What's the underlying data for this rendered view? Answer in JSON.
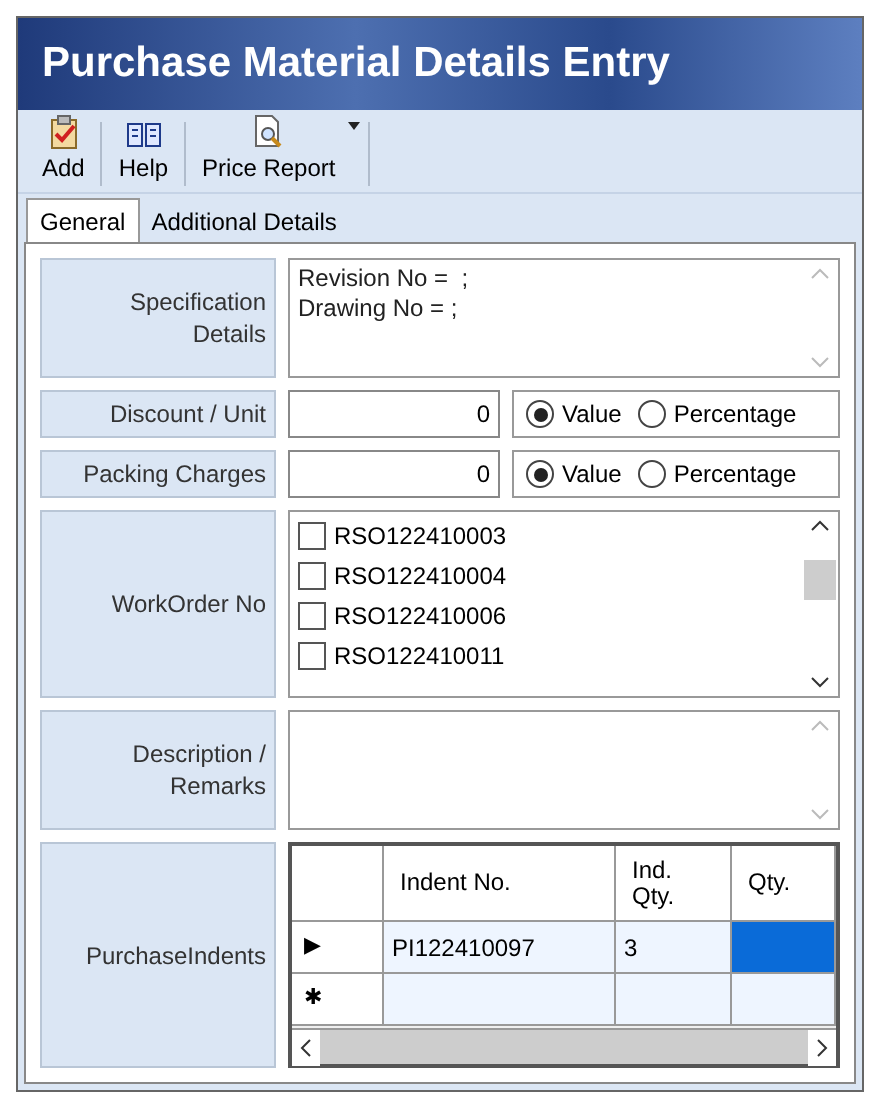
{
  "window": {
    "title": "Purchase Material Details Entry"
  },
  "toolbar": [
    {
      "label": "Add",
      "kind": "add"
    },
    {
      "label": "Help",
      "kind": "help"
    },
    {
      "label": "Price Report",
      "kind": "report",
      "dropdown": true
    }
  ],
  "tabs": [
    {
      "label": "General",
      "selected": true
    },
    {
      "label": "Additional Details",
      "selected": false
    }
  ],
  "specification": {
    "label": "Specification Details",
    "value": "Revision No =  ;\nDrawing No = ;"
  },
  "charges": [
    {
      "label": "Discount / Unit",
      "value": "0",
      "options": [
        {
          "label": "Value",
          "selected": true
        },
        {
          "label": "Percentage",
          "selected": false
        }
      ]
    },
    {
      "label": "Packing Charges",
      "value": "0",
      "options": [
        {
          "label": "Value",
          "selected": true
        },
        {
          "label": "Percentage",
          "selected": false
        }
      ]
    }
  ],
  "work_orders": {
    "label": "WorkOrder No",
    "items": [
      {
        "label": "RSO122410003",
        "checked": false
      },
      {
        "label": "RSO122410004",
        "checked": false
      },
      {
        "label": "RSO122410006",
        "checked": false
      },
      {
        "label": "RSO122410011",
        "checked": false
      }
    ]
  },
  "description": {
    "label": "Description / Remarks"
  },
  "purchase_indents": {
    "label": "PurchaseIndents",
    "columns": [
      "Indent No.",
      "Ind. Qty.",
      "Qty."
    ],
    "rows": [
      {
        "marker": "▶",
        "cells": [
          {
            "text": "PI122410097",
            "selected": false
          },
          {
            "text": "3",
            "selected": false
          },
          {
            "text": "",
            "selected": true
          }
        ]
      },
      {
        "marker": "✱",
        "cells": [
          {
            "text": "",
            "selected": false
          },
          {
            "text": "",
            "selected": false
          },
          {
            "text": "",
            "selected": false
          }
        ]
      }
    ]
  }
}
